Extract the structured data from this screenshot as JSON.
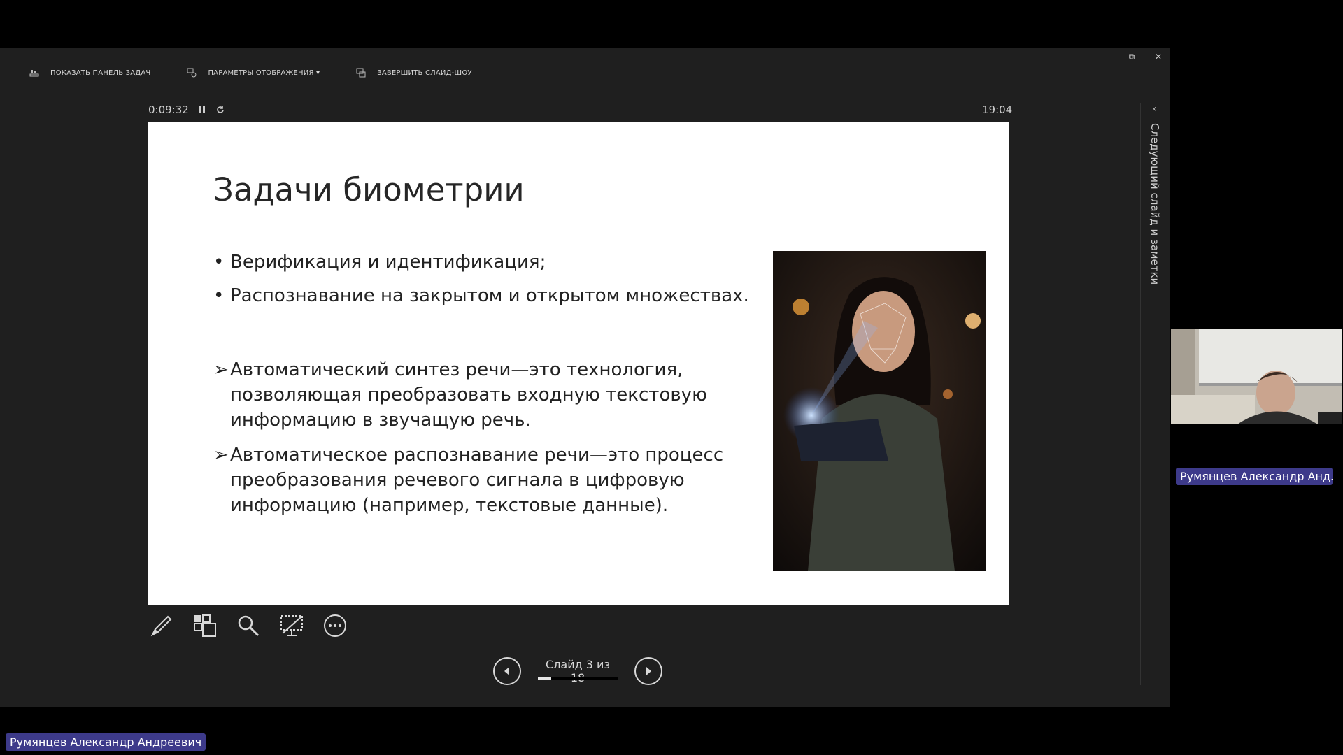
{
  "toolbar": {
    "show_taskbar": "ПОКАЗАТЬ ПАНЕЛЬ ЗАДАЧ",
    "display_settings": "ПАРАМЕТРЫ ОТОБРАЖЕНИЯ ▾",
    "end_show": "ЗАВЕРШИТЬ СЛАЙД-ШОУ"
  },
  "window": {
    "minimize": "–",
    "restore": "⧉",
    "close": "✕"
  },
  "presenter": {
    "elapsed": "0:09:32",
    "clock": "19:04",
    "side_panel_label": "Следующий слайд и заметки"
  },
  "slide": {
    "title": "Задачи биометрии",
    "bullets": [
      "Верификация и идентификация;",
      "Распознавание на закрытом и открытом множествах."
    ],
    "arrows": [
      "Автоматический  синтез  речи—это  технология, позволяющая  преобразовать входную текстовую информацию в звучащую речь.",
      "Автоматическое  распознавание  речи—это процесс преобразования  речевого сигнала в цифровую информацию (например, текстовые данные)."
    ],
    "bullet_mark": "•",
    "arrow_mark": "➢"
  },
  "navigation": {
    "slide_counter": "Слайд 3 из 18",
    "progress_fraction": 0.17
  },
  "participants": {
    "camera_name": "Румянцев Александр Анд...",
    "presenter_name": "Румянцев Александр Андреевич"
  },
  "colors": {
    "badge": "#3d3a8a",
    "background": "#1f1f1f"
  }
}
